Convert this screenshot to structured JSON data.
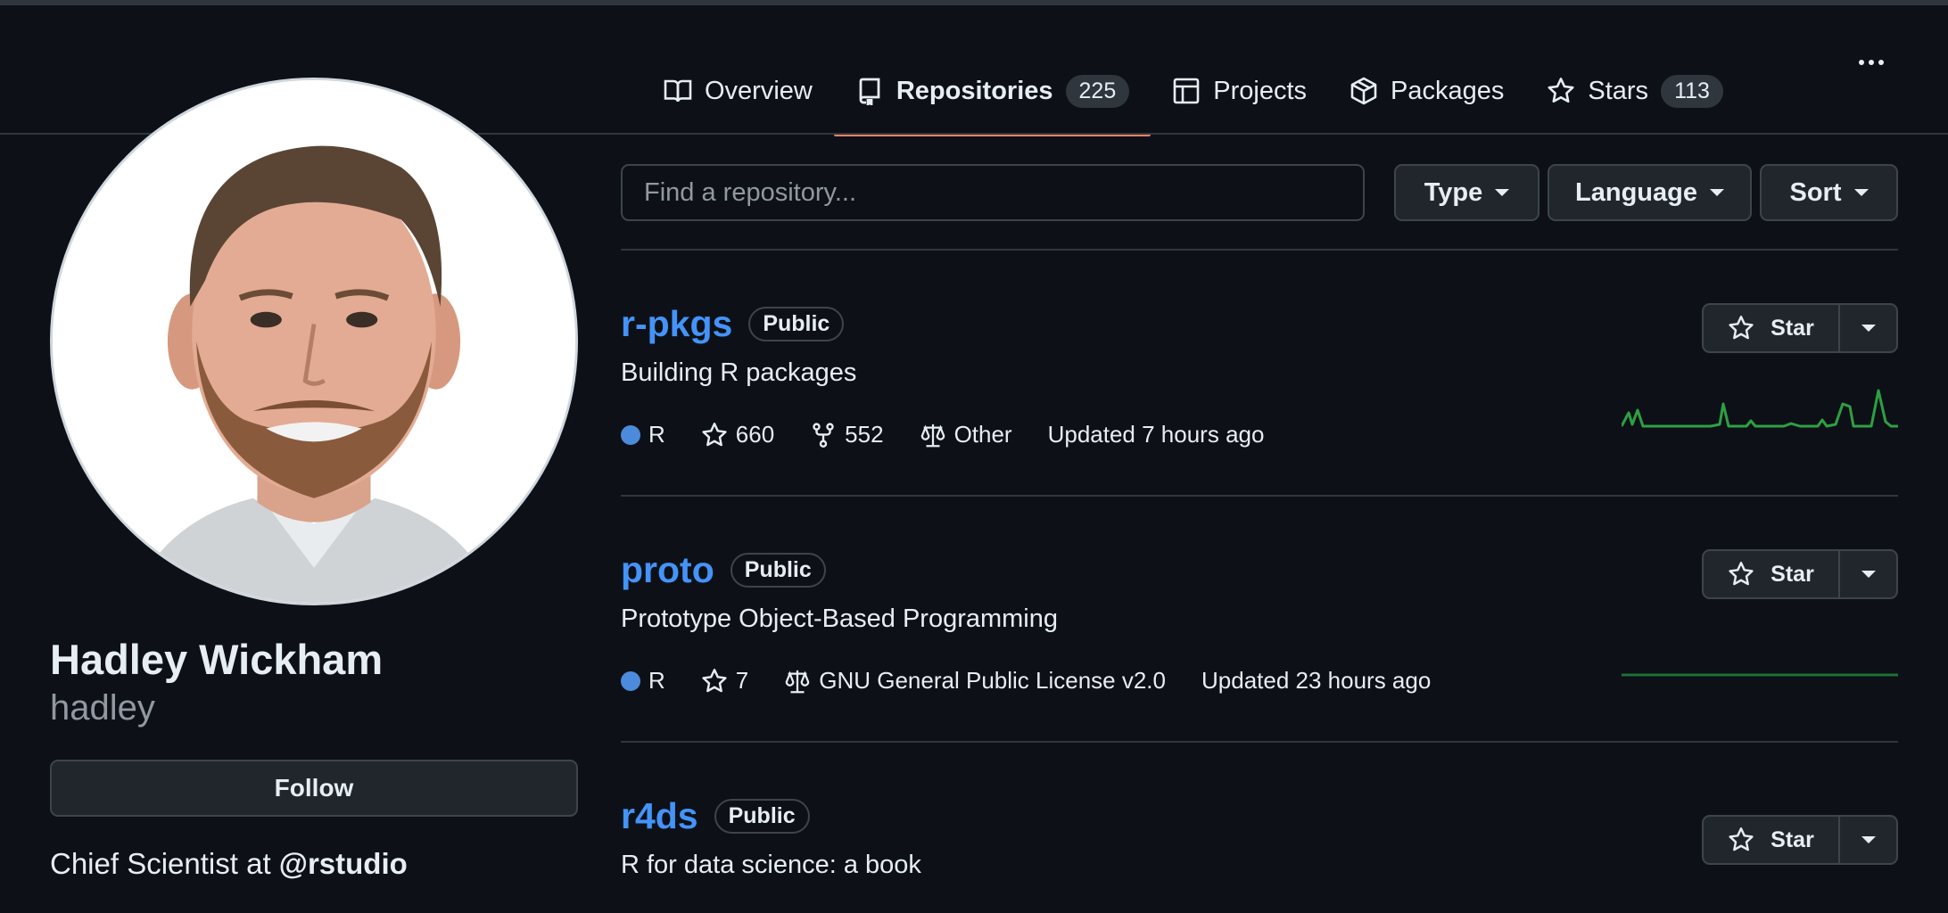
{
  "tabs": [
    {
      "label": "Overview"
    },
    {
      "label": "Repositories",
      "count": "225"
    },
    {
      "label": "Projects"
    },
    {
      "label": "Packages"
    },
    {
      "label": "Stars",
      "count": "113"
    }
  ],
  "profile": {
    "name": "Hadley Wickham",
    "login": "hadley",
    "follow_label": "Follow",
    "bio_text": "Chief Scientist at ",
    "bio_org": "@rstudio"
  },
  "search": {
    "placeholder": "Find a repository..."
  },
  "filters": {
    "type": "Type",
    "language": "Language",
    "sort": "Sort"
  },
  "repos": [
    {
      "name": "r-pkgs",
      "visibility": "Public",
      "description": "Building R packages",
      "language": "R",
      "stars": "660",
      "forks": "552",
      "license": "Other",
      "updated": "Updated 7 hours ago",
      "star_label": "Star"
    },
    {
      "name": "proto",
      "visibility": "Public",
      "description": "Prototype Object-Based Programming",
      "language": "R",
      "stars": "7",
      "license": "GNU General Public License v2.0",
      "updated": "Updated 23 hours ago",
      "star_label": "Star"
    },
    {
      "name": "r4ds",
      "visibility": "Public",
      "description": "R for data science: a book",
      "star_label": "Star"
    }
  ],
  "colors": {
    "accent_tab": "#f78166",
    "link": "#4493f8",
    "lang_r": "#4c8bdc",
    "sparkline": "#2ea043"
  },
  "icons": [
    "book-icon",
    "repo-icon",
    "table-icon",
    "package-icon",
    "star-icon",
    "fork-icon",
    "law-icon",
    "kebab-icon"
  ]
}
